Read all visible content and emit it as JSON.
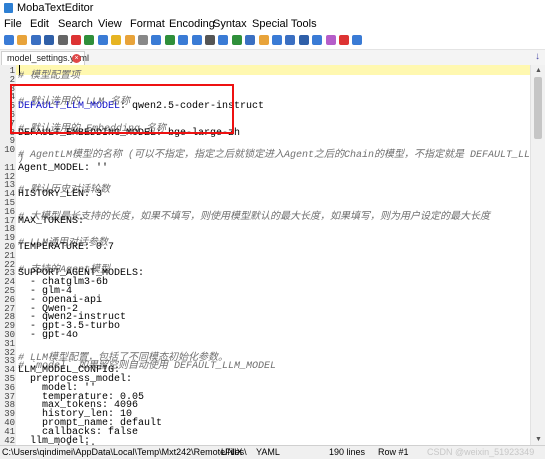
{
  "window": {
    "title": "MobaTextEditor"
  },
  "menu": [
    "File",
    "Edit",
    "Search",
    "View",
    "Format",
    "Encoding",
    "Syntax",
    "Special Tools"
  ],
  "toolbar_icons": [
    "new-file-icon",
    "open-folder-icon",
    "save-icon",
    "save-all-icon",
    "print-icon",
    "close-icon",
    "copy-icon",
    "paste-icon",
    "bookmark-icon",
    "favorite-icon",
    "cut-icon",
    "duplicate-icon",
    "find-icon",
    "search-icon",
    "replace-icon",
    "select-icon",
    "monitor-icon",
    "tree-icon",
    "open-icon",
    "text-color-icon",
    "apple-icon",
    "undo-icon",
    "column-icon",
    "help-icon",
    "brush-icon",
    "settings-icon",
    "plugin-icon"
  ],
  "tab": {
    "label": "model_settings.yaml",
    "arrow": "↓"
  },
  "scroll": {
    "up": "▲",
    "down": "▼"
  },
  "editor": {
    "lines": [
      {
        "n": "1",
        "segs": [
          [
            "c",
            "# 模型配置项"
          ]
        ]
      },
      {
        "n": "2",
        "segs": []
      },
      {
        "n": "3",
        "segs": []
      },
      {
        "n": "4",
        "segs": [
          [
            "c",
            "# 默认选用的 LLM 名称"
          ]
        ]
      },
      {
        "n": "5",
        "segs": [
          [
            "k",
            "DEFAULT_LLM_MODEL"
          ],
          [
            "t",
            ": qwen2.5-coder-instruct"
          ]
        ]
      },
      {
        "n": "6",
        "segs": []
      },
      {
        "n": "7",
        "segs": [
          [
            "c",
            "# 默认选用的 Embedding 名称"
          ]
        ]
      },
      {
        "n": "8",
        "segs": [
          [
            "t",
            "DEFAULT_EMBEDDING_MODEL: bge-large-zh"
          ]
        ]
      },
      {
        "n": "9",
        "segs": []
      },
      {
        "n": "10",
        "segs": [
          [
            "c",
            "# AgentLM模型的名称 (可以不指定，指定之后就锁定进入Agent之后的Chain的模型，不指定就是 DEFAULT_LLM_MODEL)"
          ]
        ]
      },
      {
        "n": "",
        "segs": [
          [
            "c",
            ")"
          ]
        ]
      },
      {
        "n": "11",
        "segs": [
          [
            "t",
            "Agent_MODEL: ''"
          ]
        ]
      },
      {
        "n": "12",
        "segs": []
      },
      {
        "n": "13",
        "segs": [
          [
            "c",
            "# 默认历史对话轮数"
          ]
        ]
      },
      {
        "n": "14",
        "segs": [
          [
            "t",
            "HISTORY_LEN: 3"
          ]
        ]
      },
      {
        "n": "15",
        "segs": []
      },
      {
        "n": "16",
        "segs": [
          [
            "c",
            "# 大模型最长支持的长度，如果不填写，则使用模型默认的最大长度，如果填写，则为用户设定的最大长度"
          ]
        ]
      },
      {
        "n": "17",
        "segs": [
          [
            "t",
            "MAX_TOKENS:"
          ]
        ]
      },
      {
        "n": "18",
        "segs": []
      },
      {
        "n": "19",
        "segs": [
          [
            "c",
            "# LLM通用对话参数"
          ]
        ]
      },
      {
        "n": "20",
        "segs": [
          [
            "t",
            "TEMPERATURE: 0.7"
          ]
        ]
      },
      {
        "n": "21",
        "segs": []
      },
      {
        "n": "22",
        "segs": [
          [
            "c",
            "# 支持的Agent模型"
          ]
        ]
      },
      {
        "n": "23",
        "segs": [
          [
            "t",
            "SUPPORT_AGENT_MODELS:"
          ]
        ]
      },
      {
        "n": "24",
        "segs": [
          [
            "t",
            "  - chatglm3-6b"
          ]
        ]
      },
      {
        "n": "25",
        "segs": [
          [
            "t",
            "  - glm-4"
          ]
        ]
      },
      {
        "n": "26",
        "segs": [
          [
            "t",
            "  - openai-api"
          ]
        ]
      },
      {
        "n": "27",
        "segs": [
          [
            "t",
            "  - Qwen-2"
          ]
        ]
      },
      {
        "n": "28",
        "segs": [
          [
            "t",
            "  - qwen2-instruct"
          ]
        ]
      },
      {
        "n": "29",
        "segs": [
          [
            "t",
            "  - gpt-3.5-turbo"
          ]
        ]
      },
      {
        "n": "30",
        "segs": [
          [
            "t",
            "  - gpt-4o"
          ]
        ]
      },
      {
        "n": "31",
        "segs": []
      },
      {
        "n": "32",
        "segs": [
          [
            "c",
            "# LLM模型配置，包括了不同模态初始化参数。"
          ]
        ]
      },
      {
        "n": "33",
        "segs": [
          [
            "c",
            "# `model` 如果留空则自动使用 DEFAULT_LLM_MODEL"
          ]
        ]
      },
      {
        "n": "34",
        "segs": [
          [
            "t",
            "LLM_MODEL_CONFIG:"
          ]
        ]
      },
      {
        "n": "35",
        "segs": [
          [
            "t",
            "  preprocess_model:"
          ]
        ]
      },
      {
        "n": "36",
        "segs": [
          [
            "t",
            "    model: ''"
          ]
        ]
      },
      {
        "n": "37",
        "segs": [
          [
            "t",
            "    temperature: 0.05"
          ]
        ]
      },
      {
        "n": "38",
        "segs": [
          [
            "t",
            "    max_tokens: 4096"
          ]
        ]
      },
      {
        "n": "39",
        "segs": [
          [
            "t",
            "    history_len: 10"
          ]
        ]
      },
      {
        "n": "40",
        "segs": [
          [
            "t",
            "    prompt_name: default"
          ]
        ]
      },
      {
        "n": "41",
        "segs": [
          [
            "t",
            "    callbacks: false"
          ]
        ]
      },
      {
        "n": "42",
        "segs": [
          [
            "t",
            "  llm_model:"
          ]
        ]
      },
      {
        "n": "43",
        "segs": [
          [
            "t",
            "    model: ''"
          ]
        ]
      }
    ]
  },
  "status": {
    "path": "C:\\Users\\qindimei\\AppData\\Local\\Temp\\Mxt242\\RemoteFiles\\",
    "eol": "UNIX",
    "syntax": "YAML",
    "lines": "190 lines",
    "row": "Row #1",
    "col": "Col #1",
    "watermark": "CSDN @weixin_51923349"
  }
}
